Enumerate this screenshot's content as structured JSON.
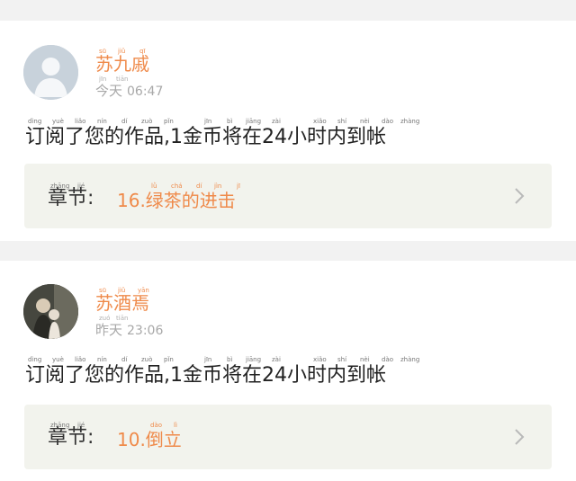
{
  "notifications": [
    {
      "user_name": "苏九戚",
      "name_pinyin": [
        "sū",
        "jiǔ",
        "qī"
      ],
      "time_label": "今天",
      "time_pinyin": [
        "jīn",
        "tiān"
      ],
      "time_value": "06:47",
      "message": "订阅了您的作品,1金币将在24小时内到帐",
      "message_pinyin": [
        "dìng",
        "yuè",
        "liǎo",
        "nín",
        "dí",
        "zuò",
        "pǐn",
        "jīn",
        "bì",
        "jiāng",
        "zài",
        "xiǎo",
        "shí",
        "nèi",
        "dào",
        "zhàng"
      ],
      "chapter_label": "章节:",
      "chapter_label_pinyin": [
        "zhāng",
        "jié"
      ],
      "chapter_title": "16.绿茶的进击",
      "chapter_title_pinyin": [
        "lǜ",
        "chá",
        "dí",
        "jìn",
        "jī"
      ],
      "avatar_icon": "default-user-avatar-icon"
    },
    {
      "user_name": "苏酒焉",
      "name_pinyin": [
        "sū",
        "jiǔ",
        "yān"
      ],
      "time_label": "昨天",
      "time_pinyin": [
        "zuó",
        "tiān"
      ],
      "time_value": "23:06",
      "message": "订阅了您的作品,1金币将在24小时内到帐",
      "message_pinyin": [
        "dìng",
        "yuè",
        "liǎo",
        "nín",
        "dí",
        "zuò",
        "pǐn",
        "jīn",
        "bì",
        "jiāng",
        "zài",
        "xiǎo",
        "shí",
        "nèi",
        "dào",
        "zhàng"
      ],
      "chapter_label": "章节:",
      "chapter_label_pinyin": [
        "zhāng",
        "jié"
      ],
      "chapter_title": "10.倒立",
      "chapter_title_pinyin": [
        "dào",
        "lì"
      ],
      "avatar_icon": "user-photo-avatar-icon"
    }
  ],
  "chevron_icon": "chevron-right-icon",
  "colors": {
    "accent": "#ef8a4a",
    "background": "#f2f2f2",
    "card": "#ffffff",
    "chapter_box": "#f2f3ed",
    "text": "#222222",
    "muted": "#a8a8a8"
  }
}
